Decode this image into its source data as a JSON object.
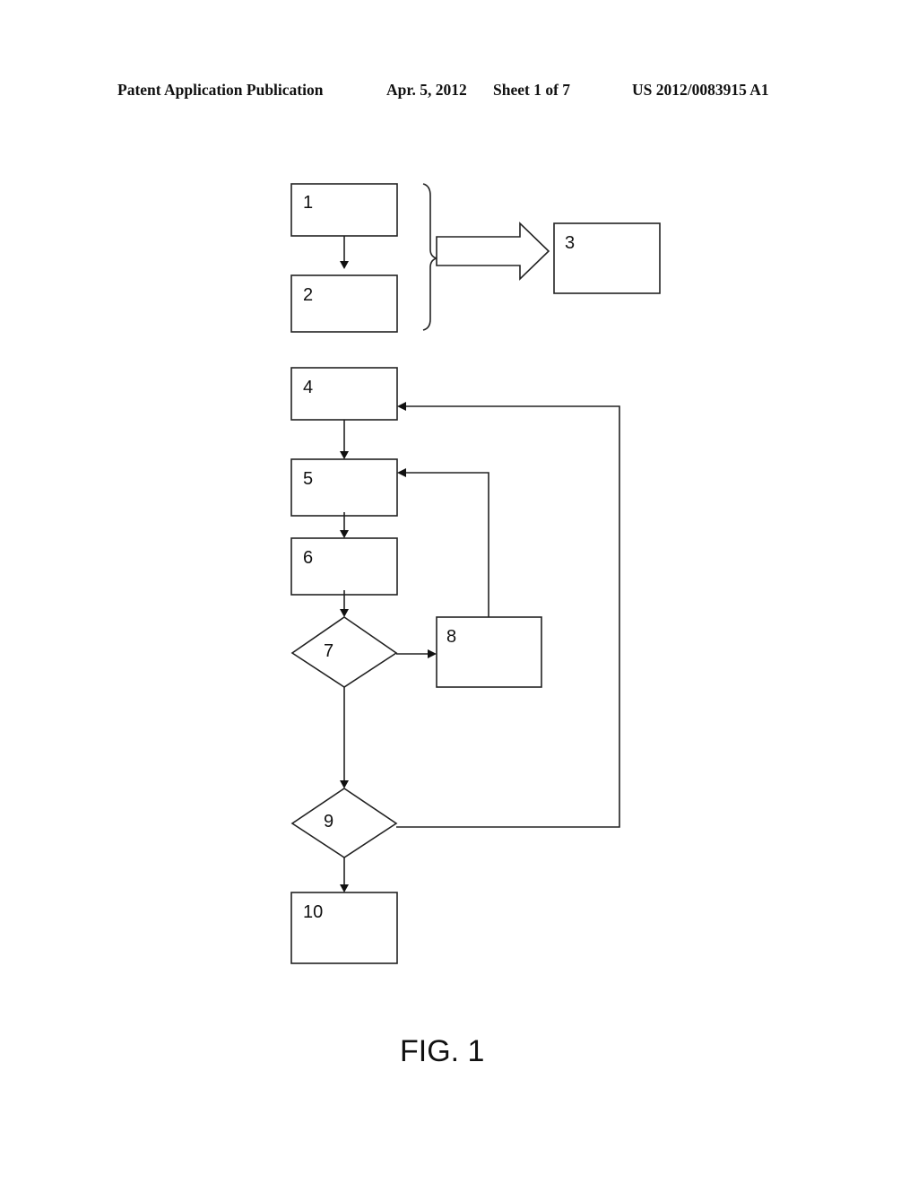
{
  "header": {
    "publication": "Patent Application Publication",
    "date": "Apr. 5, 2012",
    "sheet": "Sheet 1 of 7",
    "number": "US 2012/0083915 A1"
  },
  "diagram": {
    "nodes": [
      {
        "id": "1",
        "type": "box",
        "label": "1"
      },
      {
        "id": "2",
        "type": "box",
        "label": "2"
      },
      {
        "id": "3",
        "type": "box",
        "label": "3"
      },
      {
        "id": "4",
        "type": "box",
        "label": "4"
      },
      {
        "id": "5",
        "type": "box",
        "label": "5"
      },
      {
        "id": "6",
        "type": "box",
        "label": "6"
      },
      {
        "id": "7",
        "type": "decision",
        "label": "7"
      },
      {
        "id": "8",
        "type": "box",
        "label": "8"
      },
      {
        "id": "9",
        "type": "decision",
        "label": "9"
      },
      {
        "id": "10",
        "type": "box",
        "label": "10"
      }
    ],
    "edges": [
      {
        "from": "1",
        "to": "2"
      },
      {
        "from": "1+2",
        "to": "3",
        "style": "block-arrow-with-brace"
      },
      {
        "from": "4",
        "to": "5"
      },
      {
        "from": "5",
        "to": "6"
      },
      {
        "from": "6",
        "to": "7"
      },
      {
        "from": "7",
        "to": "8"
      },
      {
        "from": "8",
        "to": "5"
      },
      {
        "from": "7",
        "to": "9"
      },
      {
        "from": "9",
        "to": "4"
      },
      {
        "from": "9",
        "to": "10"
      }
    ]
  },
  "caption": "FIG. 1"
}
